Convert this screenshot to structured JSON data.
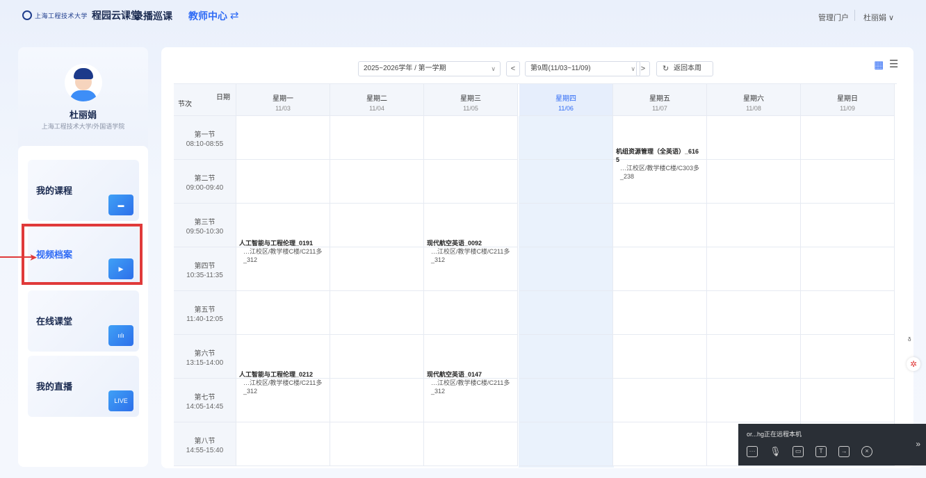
{
  "header": {
    "logo_text": "上海工程技术大学",
    "brand": "程园云课堂",
    "nav_record": "录播巡课",
    "nav_teacher": "教师中心",
    "swap_icon": "swap-arrows-icon",
    "admin": "管理门户",
    "user": "杜丽娟 ∨"
  },
  "profile": {
    "name": "杜丽娟",
    "org": "上海工程技术大学/外国语学院"
  },
  "menu": [
    {
      "label": "我的课程",
      "icon": "book-icon",
      "active": false
    },
    {
      "label": "视频档案",
      "icon": "video-folder-icon",
      "active": true
    },
    {
      "label": "在线课堂",
      "icon": "audio-wave-icon",
      "active": false
    },
    {
      "label": "我的直播",
      "icon": "live-icon",
      "icon_text": "LIVE",
      "active": false
    }
  ],
  "toolbar": {
    "term": "2025~2026学年 / 第一学期",
    "prev": "<",
    "week": "第9周(11/03~11/09)",
    "next": ">",
    "back": "返回本周",
    "view_grid_icon": "grid-view-icon",
    "view_list_icon": "list-view-icon"
  },
  "schedule": {
    "corner_date": "日期",
    "corner_period": "节次",
    "days": [
      {
        "weekday": "星期一",
        "date": "11/03",
        "today": false
      },
      {
        "weekday": "星期二",
        "date": "11/04",
        "today": false
      },
      {
        "weekday": "星期三",
        "date": "11/05",
        "today": false
      },
      {
        "weekday": "星期四",
        "date": "11/06",
        "today": true
      },
      {
        "weekday": "星期五",
        "date": "11/07",
        "today": false
      },
      {
        "weekday": "星期六",
        "date": "11/08",
        "today": false
      },
      {
        "weekday": "星期日",
        "date": "11/09",
        "today": false
      }
    ],
    "periods": [
      {
        "name": "第一节",
        "time": "08:10-08:55"
      },
      {
        "name": "第二节",
        "time": "09:00-09:40"
      },
      {
        "name": "第三节",
        "time": "09:50-10:30"
      },
      {
        "name": "第四节",
        "time": "10:35-11:35"
      },
      {
        "name": "第五节",
        "time": "11:40-12:05"
      },
      {
        "name": "第六节",
        "time": "13:15-14:00"
      },
      {
        "name": "第七节",
        "time": "14:05-14:45"
      },
      {
        "name": "第八节",
        "time": "14:55-15:40"
      }
    ],
    "courses": [
      {
        "day": 0,
        "start": 2,
        "span": 2,
        "name": "人工智能与工程伦理_0191",
        "room": "…江校区/教学楼C楼/C211多_312"
      },
      {
        "day": 2,
        "start": 2,
        "span": 2,
        "name": "现代航空英语_0092",
        "room": "…江校区/教学楼C楼/C211多_312"
      },
      {
        "day": 4,
        "start": 0,
        "span": 2,
        "name": "机组资源管理（全英语）_616\n5",
        "room": "…江校区/教学楼C楼/C303多_238"
      },
      {
        "day": 0,
        "start": 5,
        "span": 2,
        "name": "人工智能与工程伦理_0212",
        "room": "…江校区/教学楼C楼/C211多_312"
      },
      {
        "day": 2,
        "start": 5,
        "span": 2,
        "name": "现代航空英语_0147",
        "room": "…江校区/教学楼C楼/C211多_312"
      }
    ]
  },
  "remote": {
    "text": "or...hg正在远程本机",
    "icons": [
      "chat-icon",
      "mic-icon",
      "screen-icon",
      "text-icon",
      "exit-icon",
      "close-circle-icon"
    ],
    "expand": "»"
  },
  "floating": {
    "a_icon": "accessibility-icon",
    "b_icon": "app-logo-icon"
  }
}
